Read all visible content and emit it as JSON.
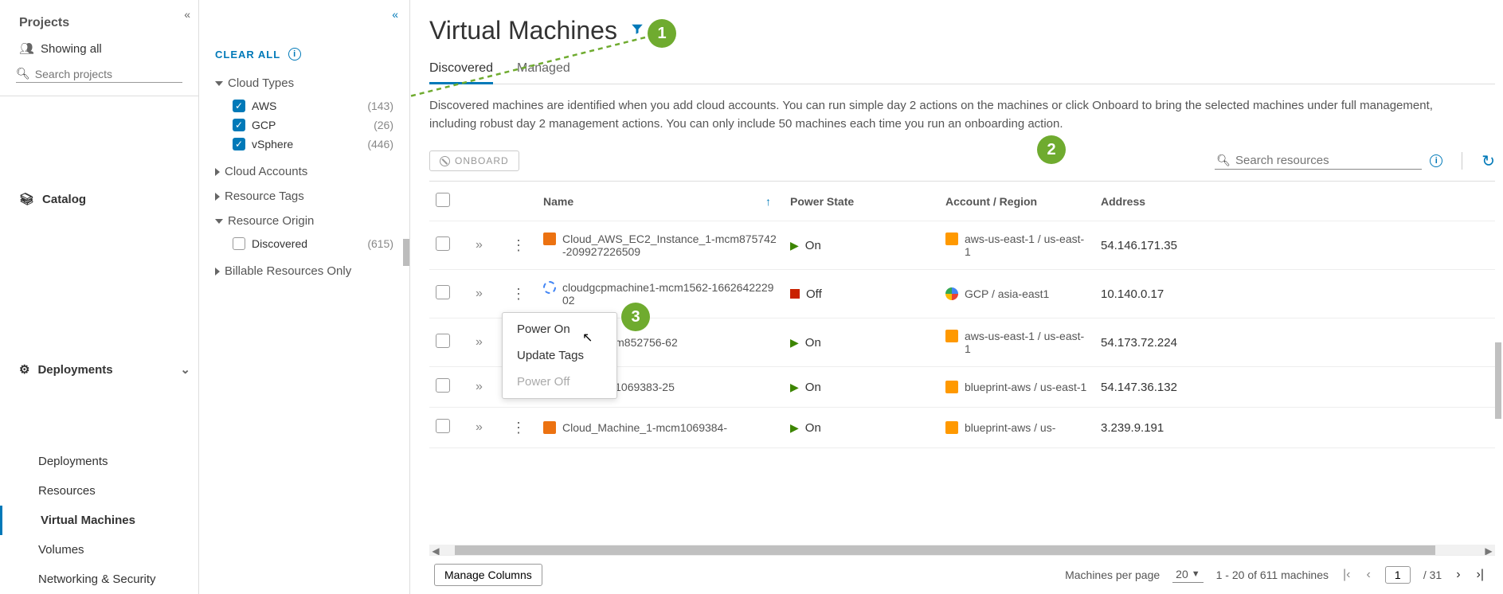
{
  "sidebar": {
    "projects_label": "Projects",
    "showing_all": "Showing all",
    "search_placeholder": "Search projects",
    "catalog": "Catalog",
    "deployments": "Deployments",
    "nav": {
      "deployments": "Deployments",
      "resources": "Resources",
      "virtual_machines": "Virtual Machines",
      "volumes": "Volumes",
      "networking": "Networking & Security"
    }
  },
  "filter": {
    "clear_all": "CLEAR ALL",
    "cloud_types": "Cloud Types",
    "aws": {
      "label": "AWS",
      "count": "(143)"
    },
    "gcp": {
      "label": "GCP",
      "count": "(26)"
    },
    "vsphere": {
      "label": "vSphere",
      "count": "(446)"
    },
    "cloud_accounts": "Cloud Accounts",
    "resource_tags": "Resource Tags",
    "resource_origin": "Resource Origin",
    "discovered": {
      "label": "Discovered",
      "count": "(615)"
    },
    "billable": "Billable Resources Only"
  },
  "page": {
    "title": "Virtual Machines",
    "tabs": {
      "discovered": "Discovered",
      "managed": "Managed"
    },
    "description": "Discovered machines are identified when you add cloud accounts. You can run simple day 2 actions on the machines or click Onboard to bring the selected machines under full management, including robust day 2 management actions. You can only include 50 machines each time you run an onboarding action.",
    "onboard": "ONBOARD",
    "search_placeholder": "Search resources"
  },
  "table": {
    "headers": {
      "name": "Name",
      "power": "Power State",
      "account": "Account / Region",
      "address": "Address"
    },
    "rows": [
      {
        "name": "Cloud_AWS_EC2_Instance_1-mcm875742-209927226509",
        "power": "On",
        "account": "aws-us-east-1 / us-east-1",
        "address": "54.146.171.35",
        "provider": "aws",
        "acct_badge": "orange"
      },
      {
        "name": "cloudgcpmachine1-mcm1562-166264222902",
        "power": "Off",
        "account": "GCP / asia-east1",
        "address": "10.140.0.17",
        "provider": "gcp",
        "acct_badge": "gcp-multi"
      },
      {
        "name": "ne_1.8-mcm852756-62",
        "power": "On",
        "account": "aws-us-east-1 / us-east-1",
        "address": "54.173.72.224",
        "provider": "aws",
        "acct_badge": "orange"
      },
      {
        "name": "ne_1-mcm1069383-25",
        "power": "On",
        "account": "blueprint-aws / us-east-1",
        "address": "54.147.36.132",
        "provider": "aws",
        "acct_badge": "orange"
      },
      {
        "name": "Cloud_Machine_1-mcm1069384-",
        "power": "On",
        "account": "blueprint-aws / us-",
        "address": "3.239.9.191",
        "provider": "aws",
        "acct_badge": "orange"
      }
    ]
  },
  "context_menu": {
    "power_on": "Power On",
    "update_tags": "Update Tags",
    "power_off": "Power Off"
  },
  "footer": {
    "manage_columns": "Manage Columns",
    "per_page_label": "Machines per page",
    "per_page_val": "20",
    "range_text": "1 - 20 of 611 machines",
    "page": "1",
    "total_pages": "/ 31"
  },
  "annotations": {
    "one": "1",
    "two": "2",
    "three": "3"
  }
}
